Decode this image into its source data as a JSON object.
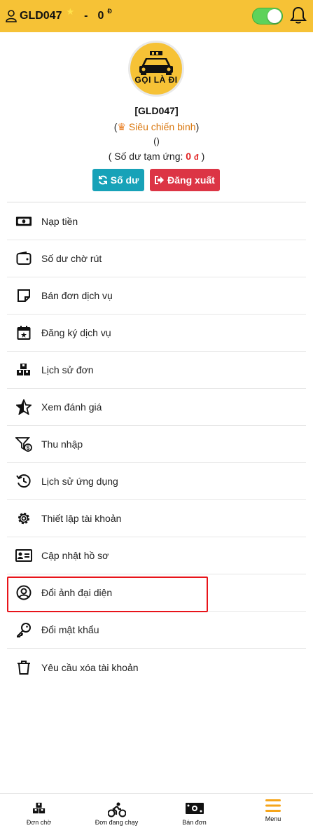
{
  "topbar": {
    "username": "GLD047",
    "star": "★",
    "dash": "-",
    "balance": "0",
    "currency": "Đ",
    "toggle_on": true,
    "accent": "#f6c236"
  },
  "profile": {
    "logo_text": "GỌI LÀ ĐI",
    "name": "[GLD047]",
    "rank_open": "(",
    "rank": "Siêu chiến binh",
    "rank_close": ")",
    "empty_parens": "()",
    "advance_label": "( Số dư tạm ứng: ",
    "advance_amount": "0",
    "advance_currency": "đ",
    "advance_close": " )"
  },
  "buttons": {
    "balance": "Số dư",
    "logout": "Đăng xuất"
  },
  "menu": [
    {
      "label": "Nạp tiền",
      "icon": "money-bill-icon"
    },
    {
      "label": "Số dư chờ rút",
      "icon": "wallet-icon"
    },
    {
      "label": "Bán đơn dịch vụ",
      "icon": "sticky-note-icon"
    },
    {
      "label": "Đăng ký dịch vụ",
      "icon": "calendar-star-icon"
    },
    {
      "label": "Lịch sử đơn",
      "icon": "boxes-icon"
    },
    {
      "label": "Xem đánh giá",
      "icon": "star-half-icon"
    },
    {
      "label": "Thu nhập",
      "icon": "funnel-dollar-icon"
    },
    {
      "label": "Lịch sử ứng dụng",
      "icon": "history-icon"
    },
    {
      "label": "Thiết lập tài khoản",
      "icon": "gear-icon"
    },
    {
      "label": "Cập nhật hồ sơ",
      "icon": "id-card-icon"
    },
    {
      "label": "Đổi ảnh đại diện",
      "icon": "user-circle-icon"
    },
    {
      "label": "Đổi mật khẩu",
      "icon": "key-icon"
    },
    {
      "label": "Yêu cầu xóa tài khoản",
      "icon": "trash-icon"
    }
  ],
  "bottom_nav": [
    {
      "label": "Đơn chờ",
      "icon": "boxes-icon"
    },
    {
      "label": "Đơn đang chạy",
      "icon": "cyclist-icon"
    },
    {
      "label": "Bán đơn",
      "icon": "money-bill-icon"
    },
    {
      "label": "Menu",
      "icon": "hamburger-icon"
    }
  ]
}
